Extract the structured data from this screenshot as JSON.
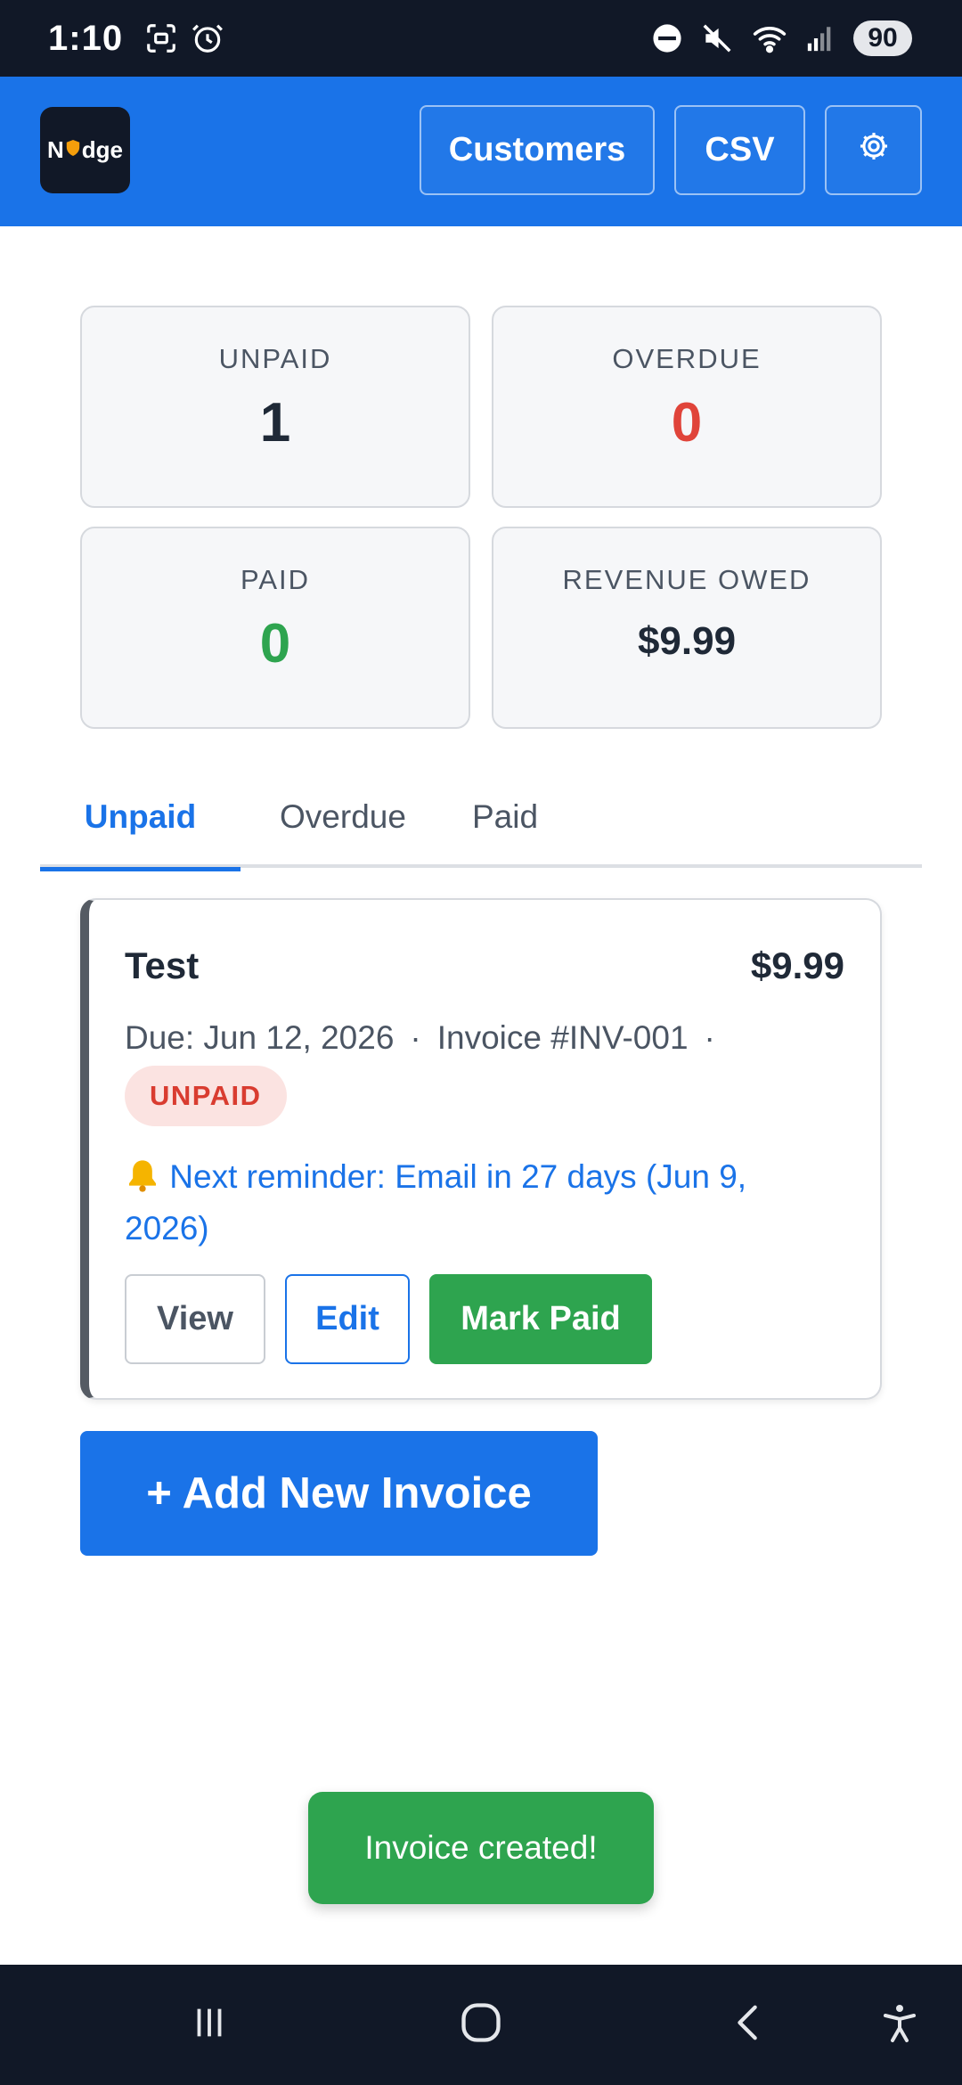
{
  "status_bar": {
    "time": "1:10",
    "battery": "90",
    "icons": [
      "screenshot-icon",
      "alarm-icon",
      "dnd-icon",
      "mute-icon",
      "wifi-icon",
      "signal-icon"
    ]
  },
  "header": {
    "logo_text_left": "N",
    "logo_text_right": "dge",
    "customers_label": "Customers",
    "csv_label": "CSV",
    "settings_icon": "gear-icon"
  },
  "stats": {
    "unpaid": {
      "label": "UNPAID",
      "value": "1"
    },
    "overdue": {
      "label": "OVERDUE",
      "value": "0"
    },
    "paid": {
      "label": "PAID",
      "value": "0"
    },
    "revenue": {
      "label": "REVENUE OWED",
      "value": "$9.99"
    }
  },
  "tabs": [
    {
      "label": "Unpaid",
      "active": true
    },
    {
      "label": "Overdue",
      "active": false
    },
    {
      "label": "Paid",
      "active": false
    }
  ],
  "invoice": {
    "name": "Test",
    "amount": "$9.99",
    "due": "Due: Jun 12, 2026",
    "separator": "·",
    "number": "Invoice #INV-001",
    "status": "UNPAID",
    "reminder": "Next reminder: Email in 27 days (Jun 9, 2026)",
    "view_label": "View",
    "edit_label": "Edit",
    "mark_paid_label": "Mark Paid"
  },
  "add_invoice_label": "+ Add New Invoice",
  "toast": "Invoice created!",
  "colors": {
    "primary": "#1a73e8",
    "success": "#2ea44f",
    "danger": "#e0443a",
    "dark": "#111827"
  }
}
